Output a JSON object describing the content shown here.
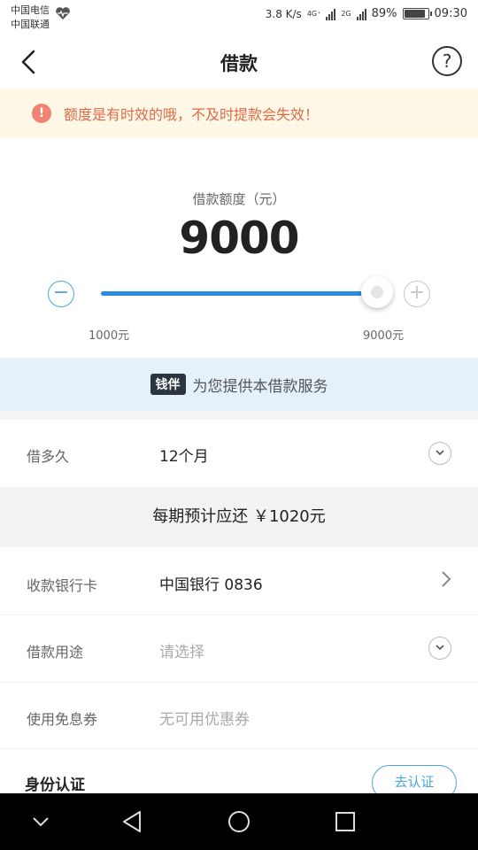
{
  "status_bar": {
    "carrier_1": "中国电信",
    "carrier_2": "中国联通",
    "speed": "3.8 K/s",
    "network_1": "4G⁺",
    "network_2": "2G",
    "battery": "89%",
    "battery_level": 0.89,
    "time": "09:30"
  },
  "header": {
    "title": "借款",
    "back_icon": "chevron-left-icon",
    "help_icon": "question-circle-icon",
    "help_glyph": "?"
  },
  "warning": {
    "icon_glyph": "!",
    "text": "额度是有时效的哦，不及时提款会失效！"
  },
  "amount": {
    "label": "借款额度（元）",
    "value": "9000",
    "min_label": "1000元",
    "max_label": "9000元",
    "min": 1000,
    "max": 9000,
    "current": 9000,
    "minus_glyph": "−",
    "plus_glyph": "+"
  },
  "provider": {
    "logo": "钱伴",
    "text": "为您提供本借款服务"
  },
  "form": {
    "term": {
      "label": "借多久",
      "value": "12个月"
    },
    "repay_text": "每期预计应还 ￥1020元",
    "bank": {
      "label": "收款银行卡",
      "value": "中国银行 0836"
    },
    "purpose": {
      "label": "借款用途",
      "placeholder": "请选择"
    },
    "coupon": {
      "label": "使用免息券",
      "placeholder": "无可用优惠券"
    },
    "identity": {
      "label": "身份认证",
      "button": "去认证"
    }
  },
  "colors": {
    "accent": "#2a8ee0",
    "warning_text": "#e06a48",
    "warning_bg": "#fff8e6",
    "provider_bg": "#e4f1fb"
  }
}
